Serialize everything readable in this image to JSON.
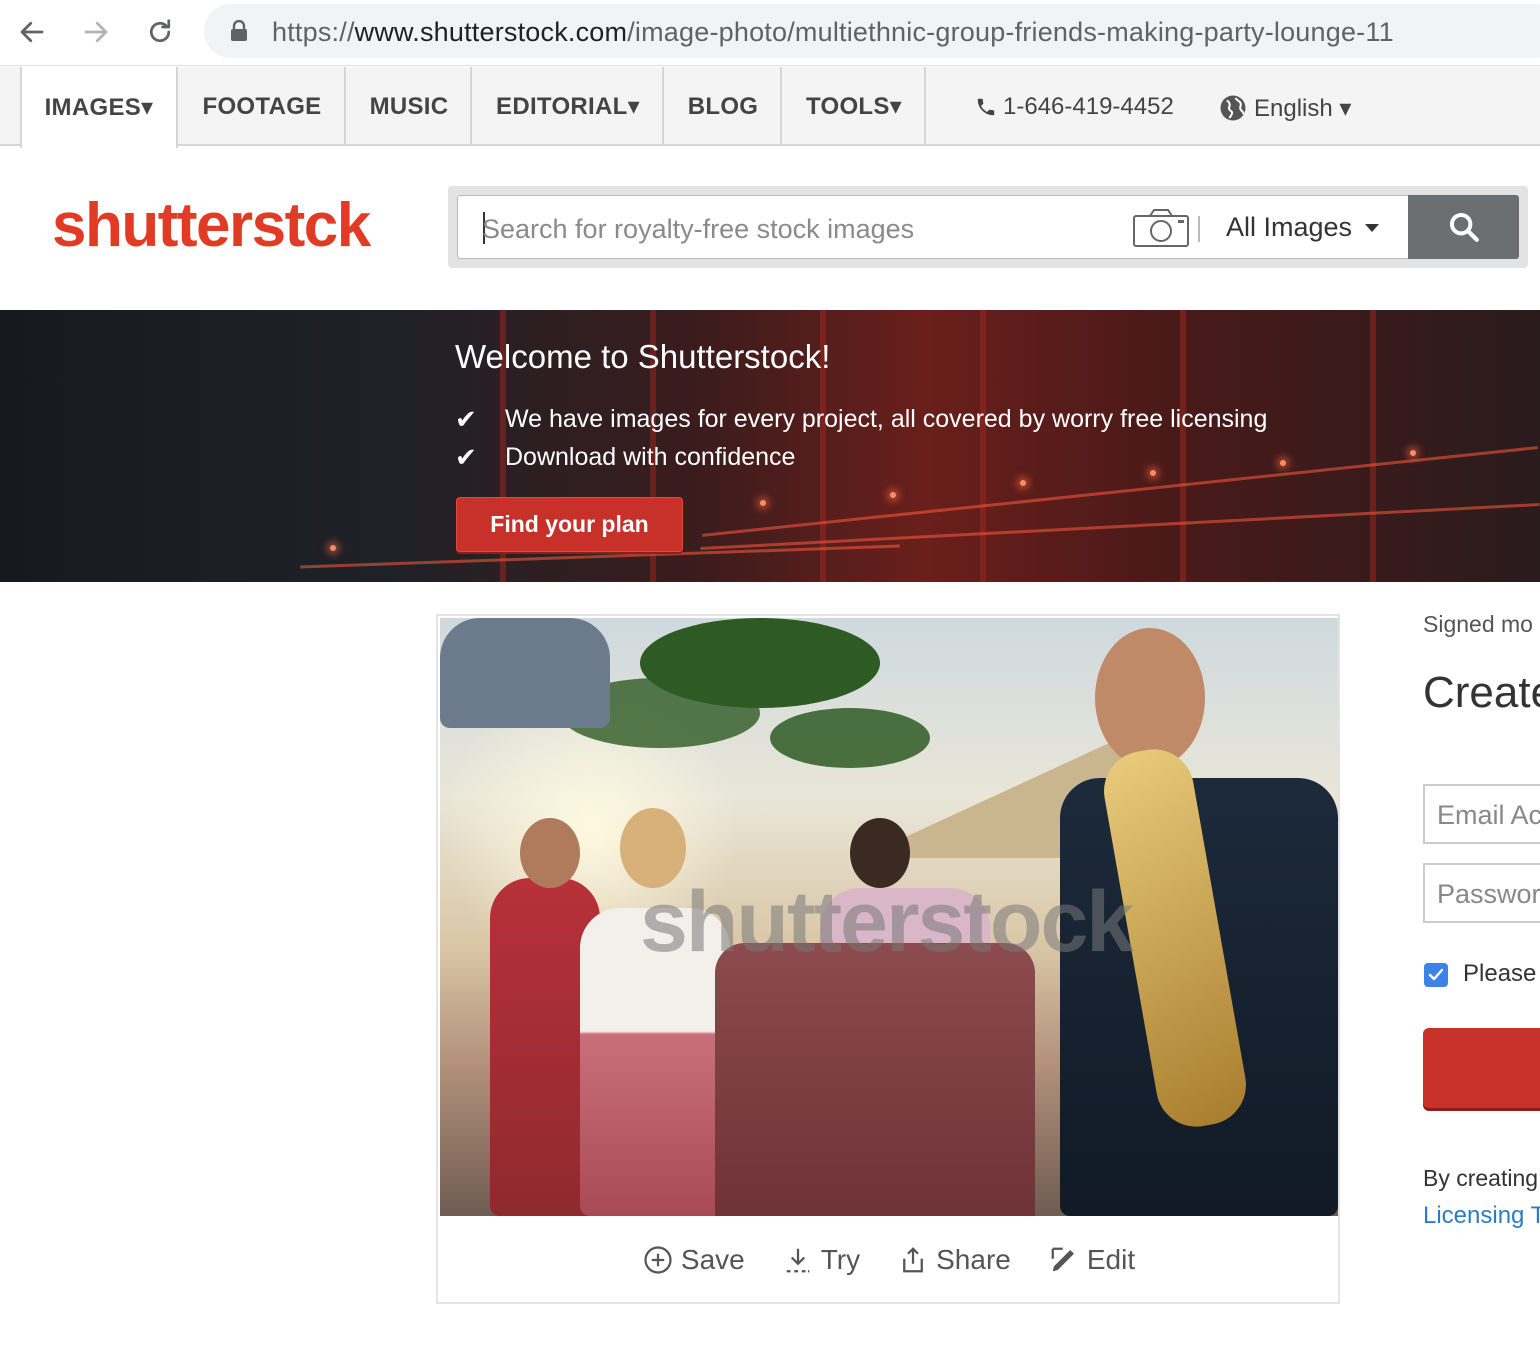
{
  "browser": {
    "url_scheme": "https://",
    "url_domain": "www.shutterstock.com",
    "url_path": "/image-photo/multiethnic-group-friends-making-party-lounge-11"
  },
  "topnav": {
    "tabs": [
      {
        "label": "IMAGES▾"
      },
      {
        "label": "FOOTAGE"
      },
      {
        "label": "MUSIC"
      },
      {
        "label": "EDITORIAL▾"
      },
      {
        "label": "BLOG"
      },
      {
        "label": "TOOLS▾"
      }
    ],
    "phone": "1-646-419-4452",
    "language": "English ▾"
  },
  "header": {
    "logo_text": "shutterst",
    "logo_tail": "ck",
    "search_placeholder": "Search for royalty-free stock images",
    "search_scope": "All Images"
  },
  "banner": {
    "title": "Welcome to Shutterstock!",
    "bullets": [
      "We have images for every project, all covered by worry free licensing",
      "Download with confidence"
    ],
    "cta": "Find your plan"
  },
  "image_card": {
    "watermark": "shutterstock",
    "actions": {
      "save": "Save",
      "try": "Try",
      "share": "Share",
      "edit": "Edit"
    }
  },
  "signup": {
    "signed": "Signed mo",
    "title": "Create",
    "email_placeholder": "Email Ac",
    "password_placeholder": "Passwor",
    "checkbox_label": "Please",
    "by_creating": "By creating",
    "licensing_link": "Licensing T"
  },
  "colors": {
    "brand_red": "#e13a25",
    "button_red": "#c8302a",
    "link_blue": "#2f7bc3",
    "search_button": "#6b6f72"
  }
}
